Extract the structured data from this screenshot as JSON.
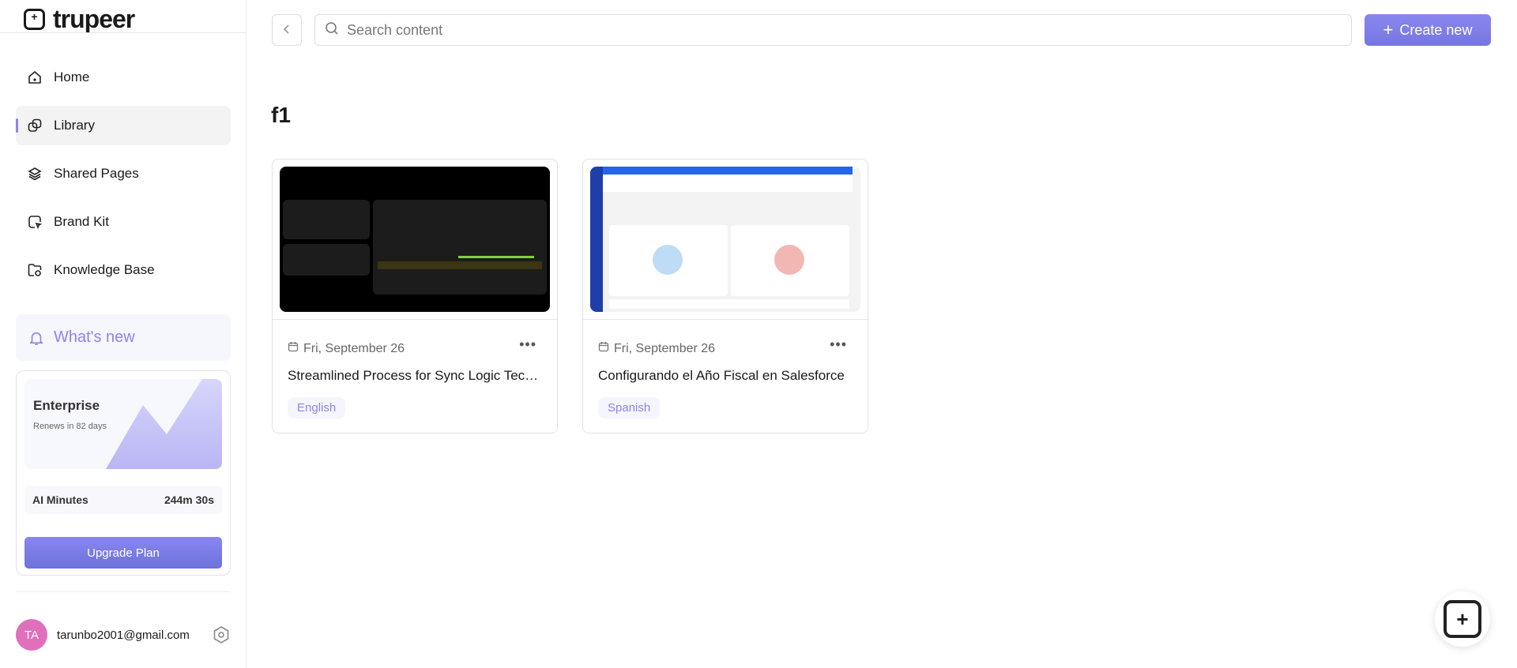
{
  "brand": {
    "name": "trupeer"
  },
  "sidebar": {
    "items": [
      {
        "label": "Home",
        "icon": "home-icon"
      },
      {
        "label": "Library",
        "icon": "library-icon",
        "active": true
      },
      {
        "label": "Shared Pages",
        "icon": "layers-icon"
      },
      {
        "label": "Brand Kit",
        "icon": "brand-kit-icon"
      },
      {
        "label": "Knowledge Base",
        "icon": "folder-icon"
      }
    ],
    "whats_new": "What's new",
    "plan": {
      "name": "Enterprise",
      "renews": "Renews in 82 days",
      "ai_minutes_label": "AI Minutes",
      "ai_minutes_value": "244m 30s",
      "upgrade_label": "Upgrade Plan"
    },
    "user": {
      "initials": "TA",
      "email": "tarunbo2001@gmail.com",
      "avatar_color": "#e06fbc"
    }
  },
  "topbar": {
    "search_placeholder": "Search content",
    "create_label": "Create new"
  },
  "main": {
    "folder_title": "f1",
    "cards": [
      {
        "date": "Fri, September 26",
        "title": "Streamlined Process for Sync Logic Technical Setup",
        "language": "English"
      },
      {
        "date": "Fri, September 26",
        "title": "Configurando el Año Fiscal en Salesforce",
        "language": "Spanish"
      }
    ]
  },
  "colors": {
    "accent": "#8b85ee",
    "accent_dark": "#6d72dc"
  }
}
